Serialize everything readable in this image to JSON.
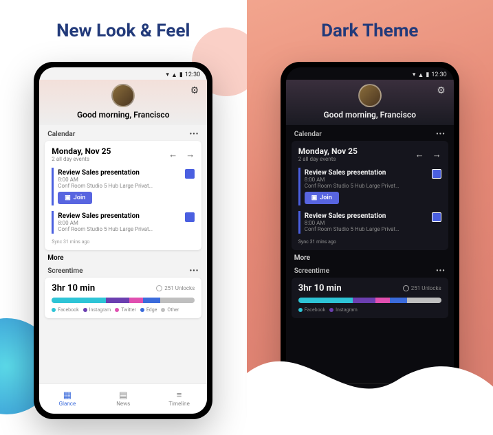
{
  "panels": {
    "left_title": "New Look & Feel",
    "right_title": "Dark Theme"
  },
  "status": {
    "time": "12:30"
  },
  "header": {
    "greeting": "Good morning, Francisco"
  },
  "calendar": {
    "section_label": "Calendar",
    "date_title": "Monday, Nov 25",
    "all_day": "2 all day events",
    "events": [
      {
        "title": "Review Sales presentation",
        "time": "8:00 AM",
        "location": "Conf Room Studio 5 Hub Large Privat…",
        "join_label": "Join"
      },
      {
        "title": "Review Sales presentation",
        "time": "8:00 AM",
        "location": "Conf Room Studio 5 Hub Large Privat…"
      }
    ],
    "sync": "Sync 31 mins ago",
    "more": "More"
  },
  "screentime": {
    "section_label": "Screentime",
    "total": "3hr 10 min",
    "unlocks": "251 Unlocks",
    "segments": [
      {
        "name": "Facebook",
        "color": "#2ec4d6",
        "pct": 38
      },
      {
        "name": "Instagram",
        "color": "#6b3fb0",
        "pct": 16
      },
      {
        "name": "Twitter",
        "color": "#e04fb0",
        "pct": 10
      },
      {
        "name": "Edge",
        "color": "#3b6bdb",
        "pct": 12
      },
      {
        "name": "Other",
        "color": "#bfbfbf",
        "pct": 24
      }
    ],
    "legend": [
      "Facebook",
      "Instagram",
      "Twitter",
      "Edge",
      "Other"
    ],
    "legend_dark": [
      "Facebook",
      "Instagram"
    ]
  },
  "nav": {
    "items": [
      {
        "label": "Glance",
        "active": true
      },
      {
        "label": "News",
        "active": false
      },
      {
        "label": "Timeline",
        "active": false
      }
    ]
  },
  "colors": {
    "accent": "#3b6bdb",
    "join": "#5865e0"
  }
}
